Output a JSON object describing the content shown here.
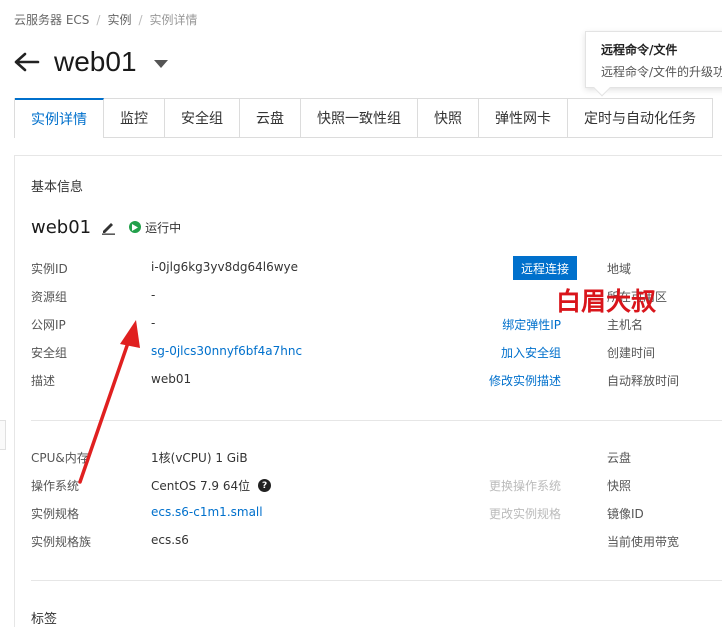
{
  "breadcrumb": {
    "items": [
      "云服务器 ECS",
      "实例",
      "实例详情"
    ],
    "separator": "/"
  },
  "header": {
    "title": "web01"
  },
  "tooltip": {
    "title": "远程命令/文件",
    "text": "远程命令/文件的升级功"
  },
  "tabs": [
    {
      "label": "实例详情",
      "active": true
    },
    {
      "label": "监控"
    },
    {
      "label": "安全组"
    },
    {
      "label": "云盘"
    },
    {
      "label": "快照一致性组"
    },
    {
      "label": "快照"
    },
    {
      "label": "弹性网卡"
    },
    {
      "label": "定时与自动化任务"
    }
  ],
  "basic_info": {
    "section_title": "基本信息",
    "instance_name": "web01",
    "status": "运行中",
    "rows": [
      {
        "label": "实例ID",
        "value": "i-0jlg6kg3yv8dg64l6wye",
        "button": "远程连接",
        "right_label": "地域"
      },
      {
        "label": "资源组",
        "value": "-",
        "right_label": "所在可用区"
      },
      {
        "label": "公网IP",
        "value": "-",
        "action": "绑定弹性IP",
        "right_label": "主机名"
      },
      {
        "label": "安全组",
        "value": "sg-0jlcs30nnyf6bf4a7hnc",
        "action": "加入安全组",
        "right_label": "创建时间"
      },
      {
        "label": "描述",
        "value": "web01",
        "action": "修改实例描述",
        "right_label": "自动释放时间"
      }
    ]
  },
  "config": {
    "rows": [
      {
        "label": "CPU&内存",
        "value": "1核(vCPU) 1 GiB",
        "right_label": "云盘"
      },
      {
        "label": "操作系统",
        "value": "CentOS 7.9 64位",
        "help": "?",
        "action": "更换操作系统",
        "right_label": "快照"
      },
      {
        "label": "实例规格",
        "value": "ecs.s6-c1m1.small",
        "action": "更改实例规格",
        "right_label": "镜像ID"
      },
      {
        "label": "实例规格族",
        "value": "ecs.s6",
        "right_label": "当前使用带宽"
      }
    ]
  },
  "tags_title": "标签",
  "watermark": "白眉大叔",
  "colors": {
    "primary": "#0070cc",
    "running": "#22a04b",
    "annotation": "#e02020",
    "watermark": "#d9151b"
  }
}
